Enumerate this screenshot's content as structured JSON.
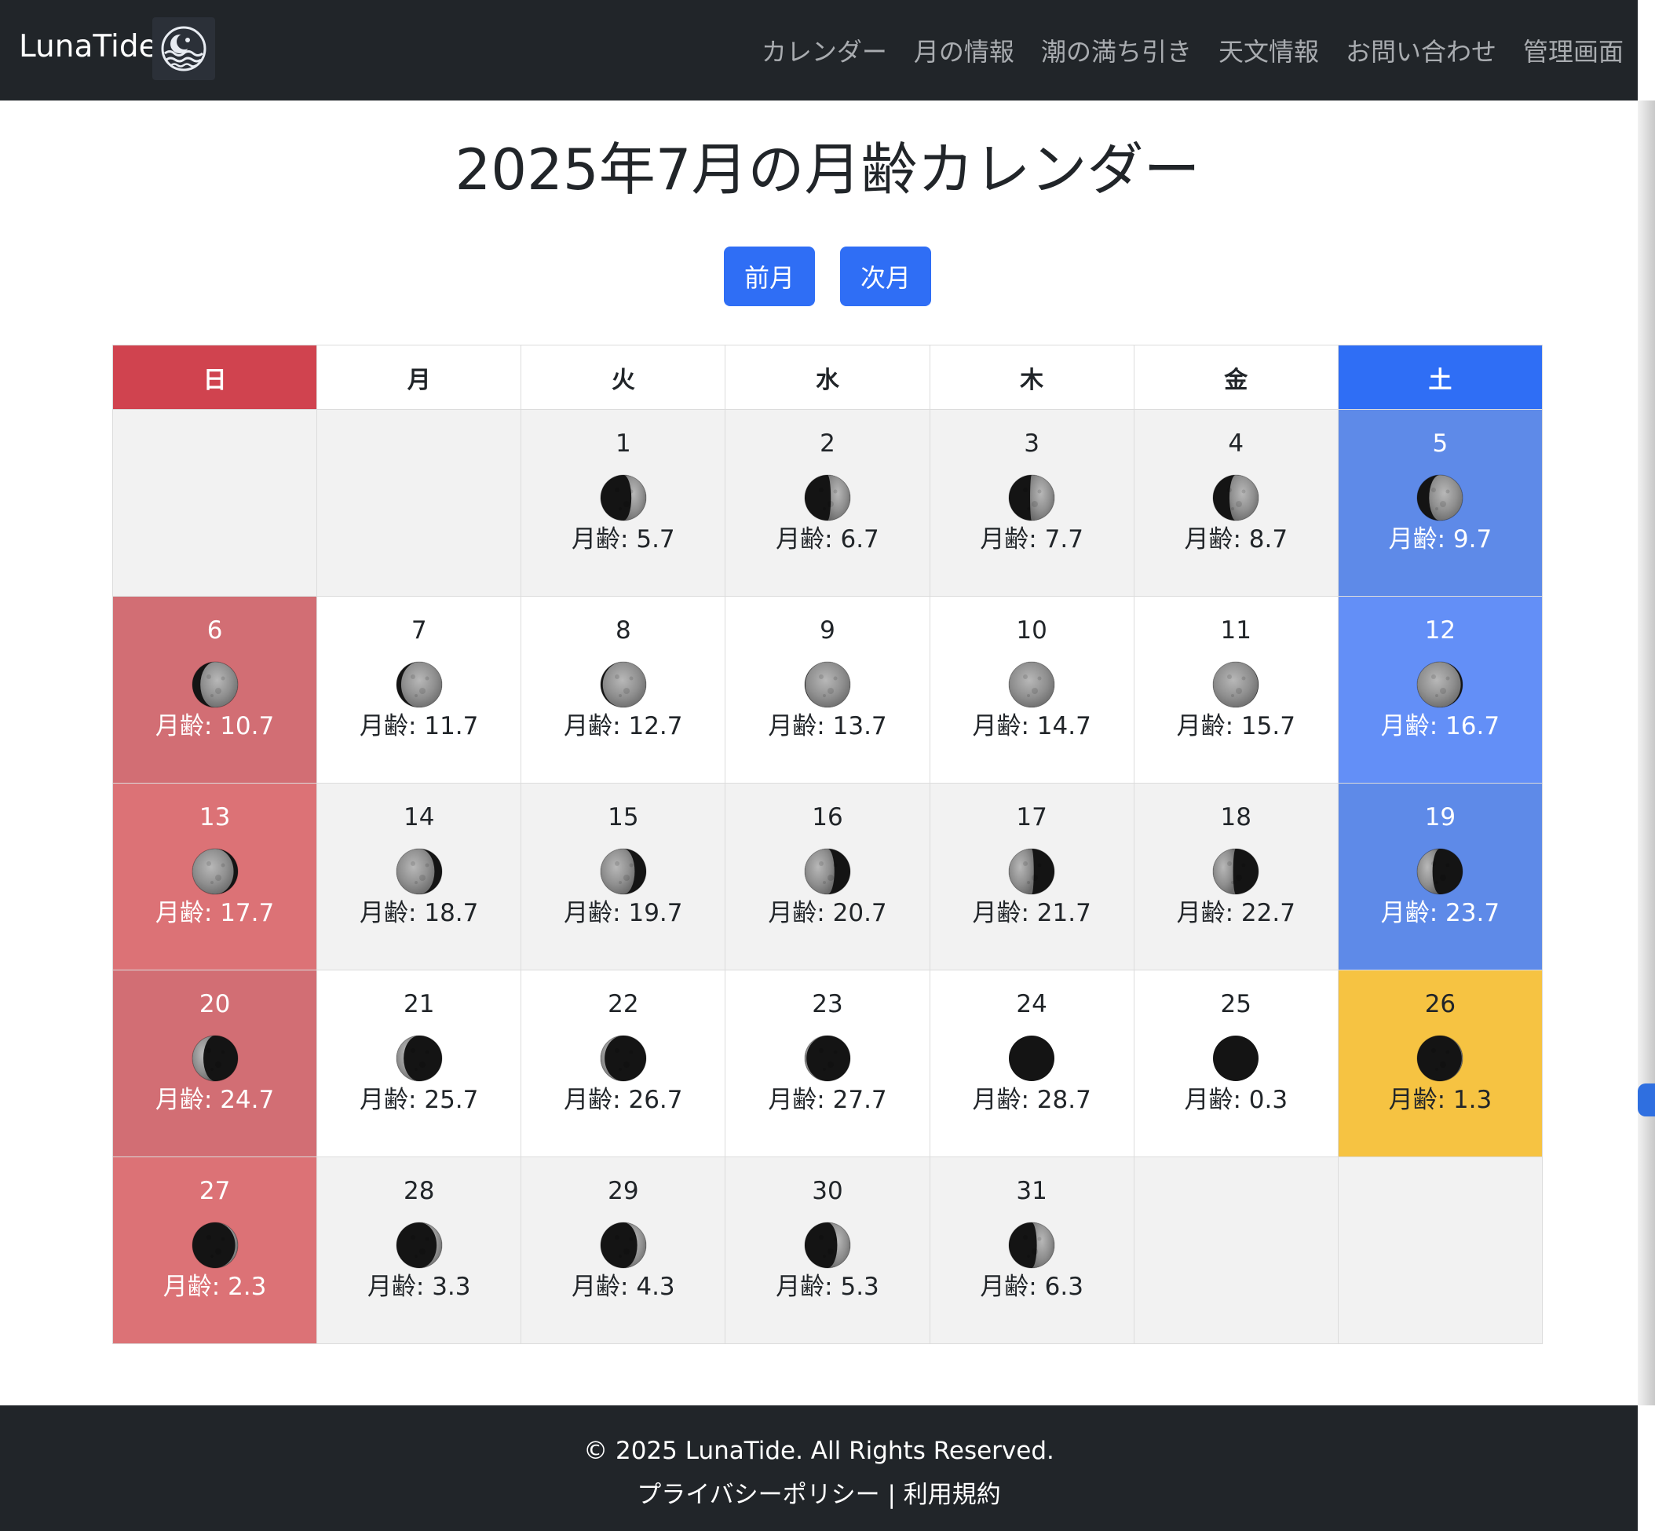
{
  "brand": {
    "name": "LunaTide",
    "logo_icon": "moon-wave-icon"
  },
  "nav": {
    "links": [
      "カレンダー",
      "月の情報",
      "潮の満ち引き",
      "天文情報",
      "お問い合わせ",
      "管理画面"
    ]
  },
  "title": "2025年7月の月齢カレンダー",
  "buttons": {
    "prev": "前月",
    "next": "次月"
  },
  "weekdays": [
    "日",
    "月",
    "火",
    "水",
    "木",
    "金",
    "土"
  ],
  "age_prefix": "月齢: ",
  "days": [
    {
      "day": 1,
      "age": 5.7
    },
    {
      "day": 2,
      "age": 6.7
    },
    {
      "day": 3,
      "age": 7.7
    },
    {
      "day": 4,
      "age": 8.7
    },
    {
      "day": 5,
      "age": 9.7
    },
    {
      "day": 6,
      "age": 10.7
    },
    {
      "day": 7,
      "age": 11.7
    },
    {
      "day": 8,
      "age": 12.7
    },
    {
      "day": 9,
      "age": 13.7
    },
    {
      "day": 10,
      "age": 14.7
    },
    {
      "day": 11,
      "age": 15.7
    },
    {
      "day": 12,
      "age": 16.7
    },
    {
      "day": 13,
      "age": 17.7
    },
    {
      "day": 14,
      "age": 18.7
    },
    {
      "day": 15,
      "age": 19.7
    },
    {
      "day": 16,
      "age": 20.7
    },
    {
      "day": 17,
      "age": 21.7
    },
    {
      "day": 18,
      "age": 22.7
    },
    {
      "day": 19,
      "age": 23.7
    },
    {
      "day": 20,
      "age": 24.7
    },
    {
      "day": 21,
      "age": 25.7
    },
    {
      "day": 22,
      "age": 26.7
    },
    {
      "day": 23,
      "age": 27.7
    },
    {
      "day": 24,
      "age": 28.7
    },
    {
      "day": 25,
      "age": 0.3
    },
    {
      "day": 26,
      "age": 1.3,
      "today": true
    },
    {
      "day": 27,
      "age": 2.3
    },
    {
      "day": 28,
      "age": 3.3
    },
    {
      "day": 29,
      "age": 4.3
    },
    {
      "day": 30,
      "age": 5.3
    },
    {
      "day": 31,
      "age": 6.3
    }
  ],
  "first_weekday": 2,
  "colors": {
    "sunday_header": "#d0434f",
    "saturday_header": "#2f6ef5",
    "sunday_cell": "#dc7276",
    "sunday_cell_alt": "#d26e74",
    "saturday_cell": "#638ff7",
    "saturday_cell_alt": "#5e8ae8",
    "today": "#f6c342",
    "stripe": "#f2f2f2",
    "white": "#ffffff"
  },
  "footer": {
    "copyright": "© 2025 LunaTide. All Rights Reserved.",
    "privacy": "プライバシーポリシー",
    "separator": " | ",
    "terms": "利用規約"
  }
}
